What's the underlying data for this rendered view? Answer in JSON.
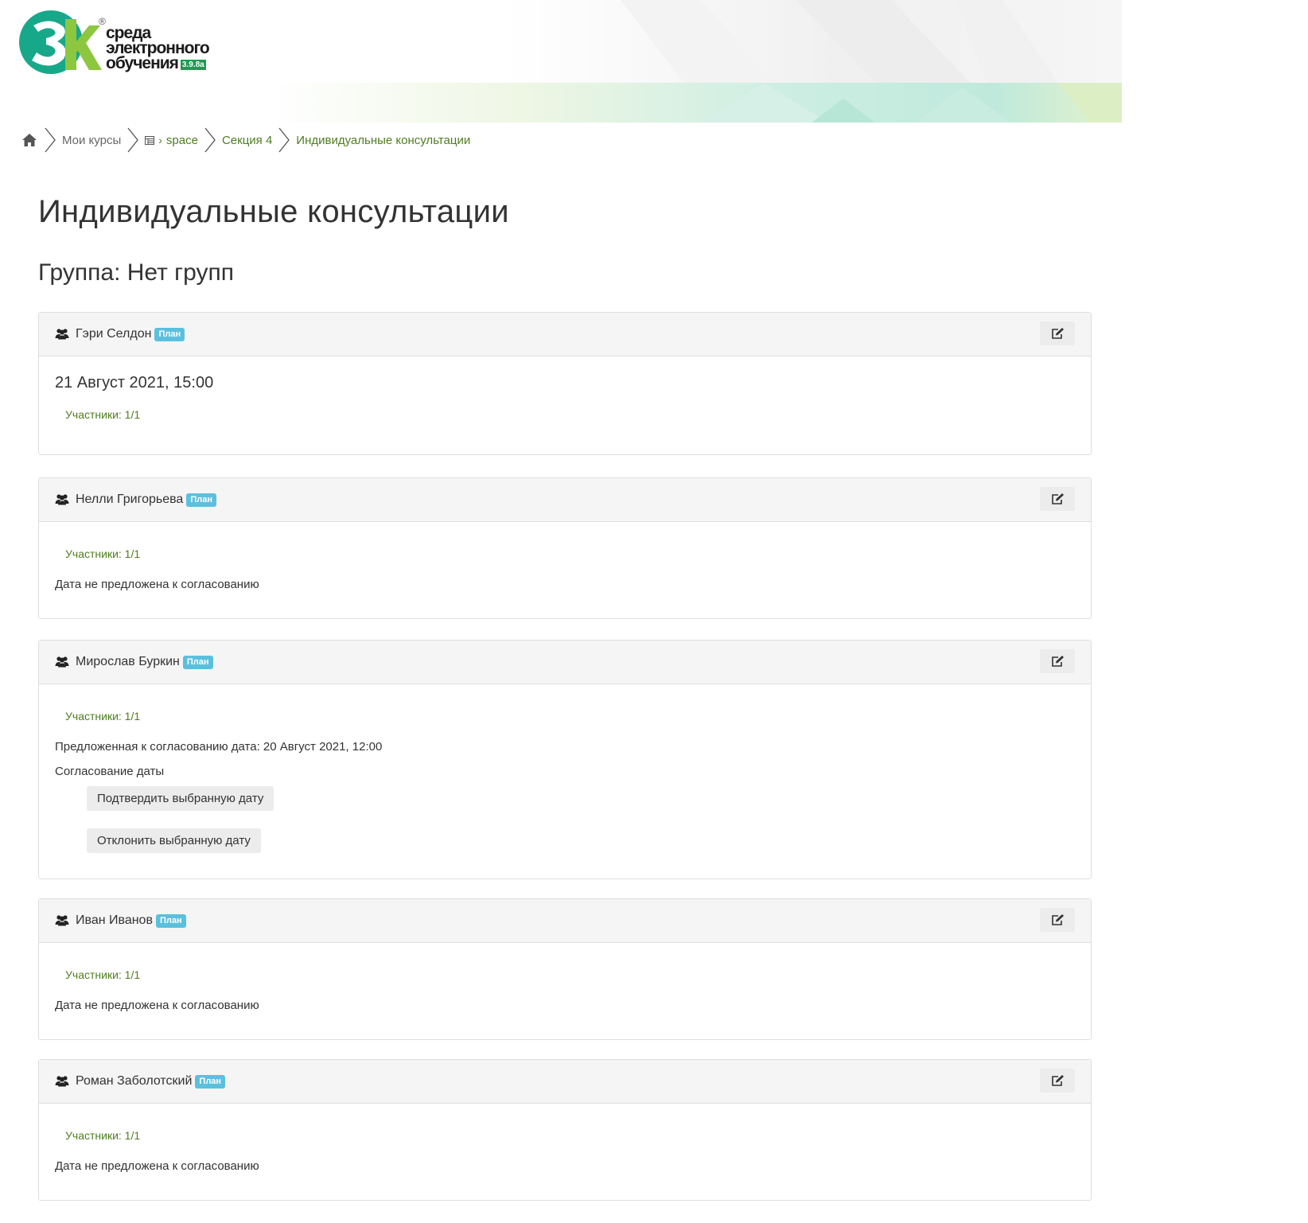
{
  "logo": {
    "line1": "среда",
    "line2": "электронного",
    "line3": "обучения",
    "version": "3.9.8a",
    "reg": "®",
    "mark": "3k"
  },
  "breadcrumb": {
    "home_icon": "home-icon",
    "items": [
      "Мои курсы",
      "space",
      "Секция 4",
      "Индивидуальные консультации"
    ]
  },
  "page": {
    "title": "Индивидуальные консультации",
    "group": "Группа: Нет групп"
  },
  "colors": {
    "accent_green": "#4f7d1f",
    "badge": "#5bc0de",
    "logo_green": "#1f9a52"
  },
  "cards": [
    {
      "name": "Гэри Селдон",
      "badge": "План",
      "date": "21 Август 2021, 15:00",
      "participants": "Участники: 1/1"
    },
    {
      "name": "Нелли Григорьева",
      "badge": "План",
      "participants": "Участники: 1/1",
      "status": "Дата не предложена к согласованию"
    },
    {
      "name": "Мирослав Буркин",
      "badge": "План",
      "participants": "Участники: 1/1",
      "proposed": "Предложенная к согласованию дата: 20 Август 2021, 12:00",
      "approval_label": "Согласование даты",
      "confirm_button": "Подтвердить выбранную дату",
      "reject_button": "Отклонить выбранную дату"
    },
    {
      "name": "Иван Иванов",
      "badge": "План",
      "participants": "Участники: 1/1",
      "status": "Дата не предложена к согласованию"
    },
    {
      "name": "Роман Заболотский",
      "badge": "План",
      "participants": "Участники: 1/1",
      "status": "Дата не предложена к согласованию"
    }
  ]
}
